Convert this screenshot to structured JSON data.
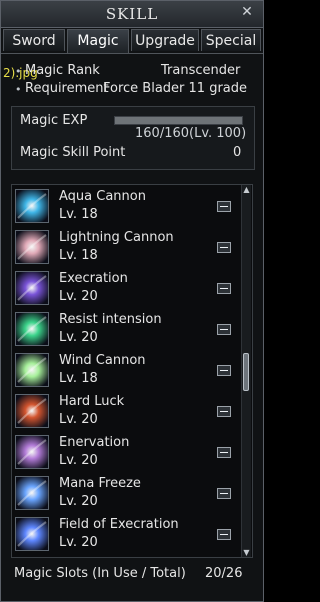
{
  "window": {
    "title": "SKILL"
  },
  "tabs": [
    {
      "label": "Sword",
      "active": false
    },
    {
      "label": "Magic",
      "active": true
    },
    {
      "label": "Upgrade",
      "active": false
    },
    {
      "label": "Special",
      "active": false
    }
  ],
  "overlay_text": "2).jpg",
  "info": {
    "rank_label": "Magic Rank",
    "rank_value": "Transcender",
    "requirement_label": "Requirement",
    "requirement_value": "Force Blader 11 grade"
  },
  "exp": {
    "label": "Magic EXP",
    "value_text": "160/160(Lv. 100)",
    "fill_fraction": 1.0,
    "skill_point_label": "Magic Skill Point",
    "skill_point_value": "0"
  },
  "skills": [
    {
      "name": "Aqua Cannon",
      "level": "Lv. 18",
      "icon": "aqua-cannon-icon",
      "color": "#3fb6e8"
    },
    {
      "name": "Lightning Cannon",
      "level": "Lv. 18",
      "icon": "lightning-cannon-icon",
      "color": "#e0a9b7"
    },
    {
      "name": "Execration",
      "level": "Lv. 20",
      "icon": "execration-icon",
      "color": "#7a54d8"
    },
    {
      "name": "Resist intension",
      "level": "Lv. 20",
      "icon": "resist-intension-icon",
      "color": "#3cd48b"
    },
    {
      "name": "Wind Cannon",
      "level": "Lv. 18",
      "icon": "wind-cannon-icon",
      "color": "#a7f09a"
    },
    {
      "name": "Hard Luck",
      "level": "Lv. 20",
      "icon": "hard-luck-icon",
      "color": "#d3552f"
    },
    {
      "name": "Enervation",
      "level": "Lv. 20",
      "icon": "enervation-icon",
      "color": "#b37cd8"
    },
    {
      "name": "Mana Freeze",
      "level": "Lv. 20",
      "icon": "mana-freeze-icon",
      "color": "#6aa5ff"
    },
    {
      "name": "Field of Execration",
      "level": "Lv. 20",
      "icon": "field-of-execration-icon",
      "color": "#5e87ff"
    }
  ],
  "slots": {
    "label": "Magic Slots (In Use / Total)",
    "value": "20/26"
  }
}
